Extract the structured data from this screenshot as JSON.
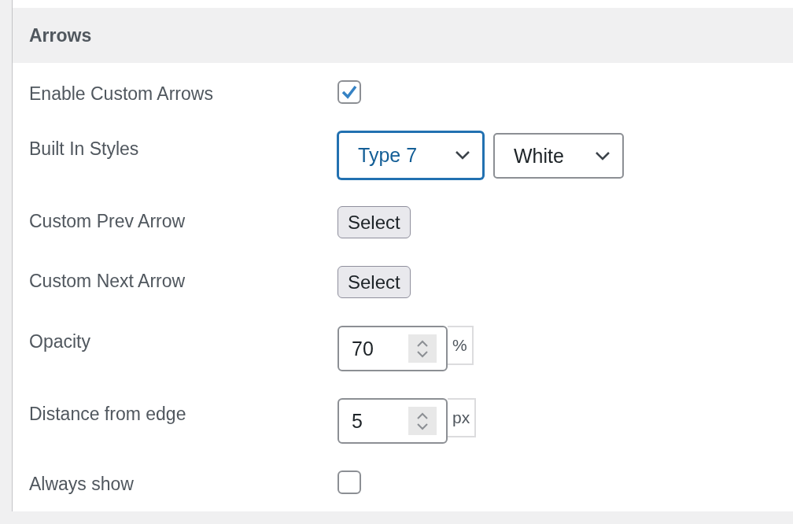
{
  "section": {
    "title": "Arrows"
  },
  "rows": [
    {
      "kind": "checkbox",
      "label": "Enable Custom Arrows",
      "checked": true
    },
    {
      "kind": "selects",
      "label": "Built In Styles",
      "selects": [
        {
          "value": "Type 7",
          "focused": true
        },
        {
          "value": "White",
          "focused": false
        }
      ]
    },
    {
      "kind": "button",
      "label": "Custom Prev Arrow",
      "button": "Select"
    },
    {
      "kind": "button",
      "label": "Custom Next Arrow",
      "button": "Select"
    },
    {
      "kind": "number",
      "label": "Opacity",
      "value": "70",
      "unit": "%"
    },
    {
      "kind": "number",
      "label": "Distance from edge",
      "value": "5",
      "unit": "px"
    },
    {
      "kind": "checkbox",
      "label": "Always show",
      "checked": false
    }
  ]
}
